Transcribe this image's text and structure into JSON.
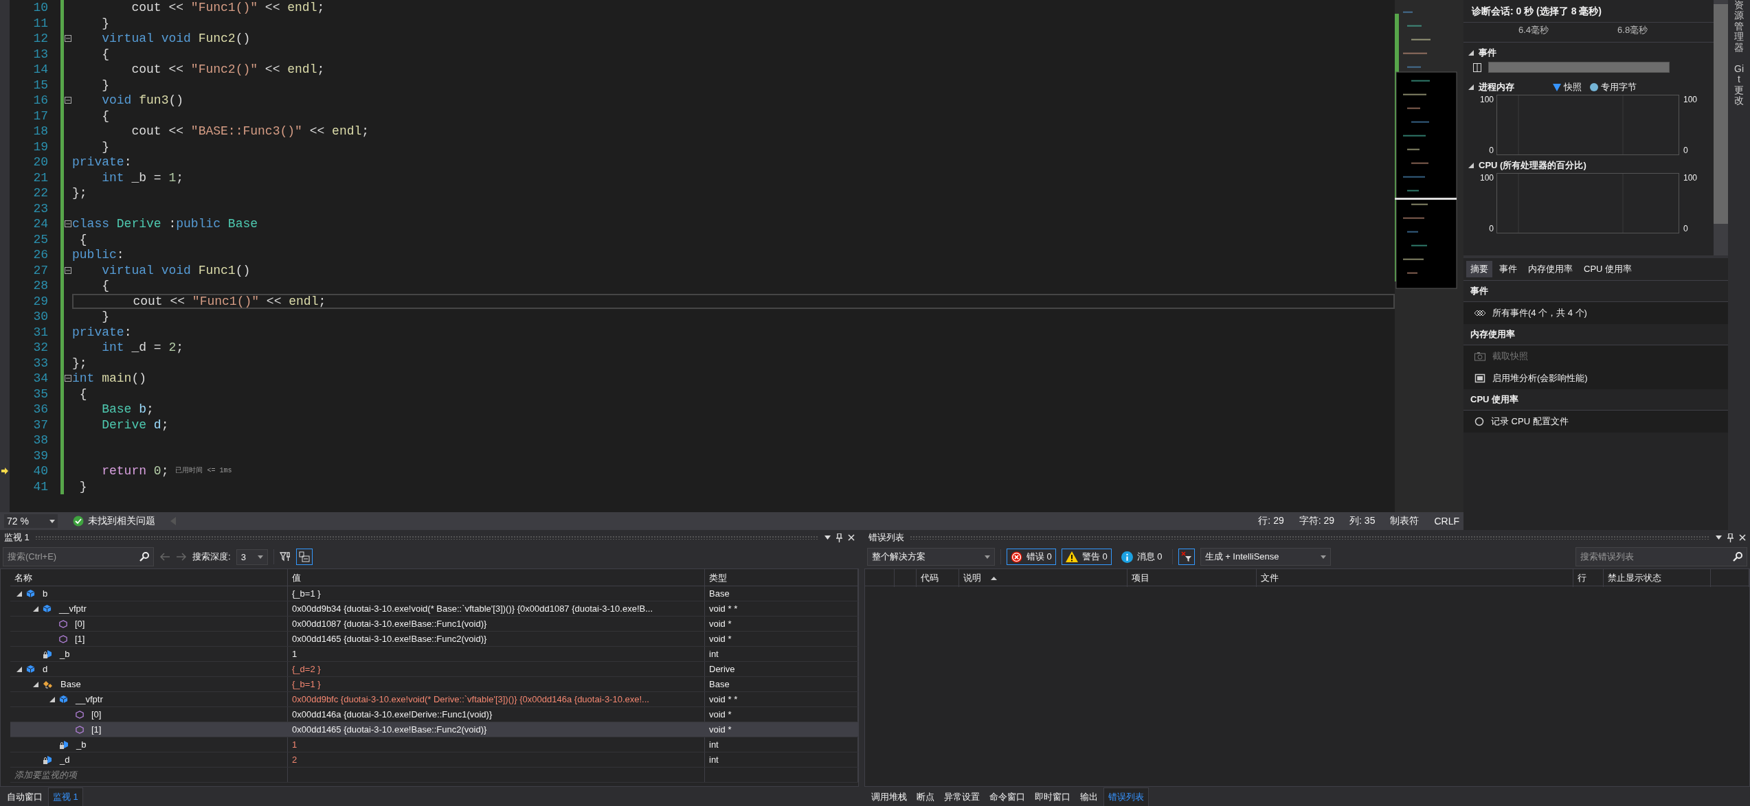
{
  "editor": {
    "lines": [
      {
        "number": "10",
        "fold": false,
        "current": false,
        "execution": false,
        "tokens": [
          {
            "text": "        cout << ",
            "kind": "plain"
          },
          {
            "text": "\"Func1()\"",
            "kind": "str"
          },
          {
            "text": " << ",
            "kind": "plain"
          },
          {
            "text": "endl",
            "kind": "fn"
          },
          {
            "text": ";",
            "kind": "plain"
          }
        ]
      },
      {
        "number": "11",
        "fold": false,
        "current": false,
        "execution": false,
        "tokens": [
          {
            "text": "    }",
            "kind": "plain"
          }
        ]
      },
      {
        "number": "12",
        "fold": true,
        "current": false,
        "execution": false,
        "tokens": [
          {
            "text": "    virtual",
            "kind": "kw"
          },
          {
            "text": " void",
            "kind": "kw"
          },
          {
            "text": " Func2",
            "kind": "fn"
          },
          {
            "text": "()",
            "kind": "plain"
          }
        ]
      },
      {
        "number": "13",
        "fold": false,
        "current": false,
        "execution": false,
        "tokens": [
          {
            "text": "    {",
            "kind": "plain"
          }
        ]
      },
      {
        "number": "14",
        "fold": false,
        "current": false,
        "execution": false,
        "tokens": [
          {
            "text": "        cout << ",
            "kind": "plain"
          },
          {
            "text": "\"Func2()\"",
            "kind": "str"
          },
          {
            "text": " << ",
            "kind": "plain"
          },
          {
            "text": "endl",
            "kind": "fn"
          },
          {
            "text": ";",
            "kind": "plain"
          }
        ]
      },
      {
        "number": "15",
        "fold": false,
        "current": false,
        "execution": false,
        "tokens": [
          {
            "text": "    }",
            "kind": "plain"
          }
        ]
      },
      {
        "number": "16",
        "fold": true,
        "current": false,
        "execution": false,
        "tokens": [
          {
            "text": "    void",
            "kind": "kw"
          },
          {
            "text": " fun3",
            "kind": "fn"
          },
          {
            "text": "()",
            "kind": "plain"
          }
        ]
      },
      {
        "number": "17",
        "fold": false,
        "current": false,
        "execution": false,
        "tokens": [
          {
            "text": "    {",
            "kind": "plain"
          }
        ]
      },
      {
        "number": "18",
        "fold": false,
        "current": false,
        "execution": false,
        "tokens": [
          {
            "text": "        cout << ",
            "kind": "plain"
          },
          {
            "text": "\"BASE::Func3()\"",
            "kind": "str"
          },
          {
            "text": " << ",
            "kind": "plain"
          },
          {
            "text": "endl",
            "kind": "fn"
          },
          {
            "text": ";",
            "kind": "plain"
          }
        ]
      },
      {
        "number": "19",
        "fold": false,
        "current": false,
        "execution": false,
        "tokens": [
          {
            "text": "    }",
            "kind": "plain"
          }
        ]
      },
      {
        "number": "20",
        "fold": false,
        "current": false,
        "execution": false,
        "tokens": [
          {
            "text": "private",
            "kind": "kw"
          },
          {
            "text": ":",
            "kind": "plain"
          }
        ]
      },
      {
        "number": "21",
        "fold": false,
        "current": false,
        "execution": false,
        "tokens": [
          {
            "text": "    int",
            "kind": "kw"
          },
          {
            "text": " _b = ",
            "kind": "plain"
          },
          {
            "text": "1",
            "kind": "num"
          },
          {
            "text": ";",
            "kind": "plain"
          }
        ]
      },
      {
        "number": "22",
        "fold": false,
        "current": false,
        "execution": false,
        "tokens": [
          {
            "text": "};",
            "kind": "plain"
          }
        ]
      },
      {
        "number": "23",
        "fold": false,
        "current": false,
        "execution": false
      },
      {
        "number": "24",
        "fold": true,
        "current": false,
        "execution": false,
        "tokens": [
          {
            "text": "class",
            "kind": "kw"
          },
          {
            "text": " Derive",
            "kind": "type"
          },
          {
            "text": " :",
            "kind": "plain"
          },
          {
            "text": "public",
            "kind": "kw"
          },
          {
            "text": " Base",
            "kind": "type"
          }
        ]
      },
      {
        "number": "25",
        "fold": false,
        "current": false,
        "execution": false,
        "tokens": [
          {
            "text": " {",
            "kind": "plain"
          }
        ]
      },
      {
        "number": "26",
        "fold": false,
        "current": false,
        "execution": false,
        "tokens": [
          {
            "text": "public",
            "kind": "kw"
          },
          {
            "text": ":",
            "kind": "plain"
          }
        ]
      },
      {
        "number": "27",
        "fold": true,
        "current": false,
        "execution": false,
        "tokens": [
          {
            "text": "    virtual",
            "kind": "kw"
          },
          {
            "text": " void",
            "kind": "kw"
          },
          {
            "text": " Func1",
            "kind": "fn"
          },
          {
            "text": "()",
            "kind": "plain"
          }
        ]
      },
      {
        "number": "28",
        "fold": false,
        "current": false,
        "execution": false,
        "tokens": [
          {
            "text": "    {",
            "kind": "plain"
          }
        ]
      },
      {
        "number": "29",
        "fold": false,
        "current": true,
        "execution": false,
        "tokens": [
          {
            "text": "        cout << ",
            "kind": "plain"
          },
          {
            "text": "\"Func1()\"",
            "kind": "str"
          },
          {
            "text": " << ",
            "kind": "plain"
          },
          {
            "text": "endl",
            "kind": "fn"
          },
          {
            "text": ";",
            "kind": "plain"
          }
        ]
      },
      {
        "number": "30",
        "fold": false,
        "current": false,
        "execution": false,
        "tokens": [
          {
            "text": "    }",
            "kind": "plain"
          }
        ]
      },
      {
        "number": "31",
        "fold": false,
        "current": false,
        "execution": false,
        "tokens": [
          {
            "text": "private",
            "kind": "kw"
          },
          {
            "text": ":",
            "kind": "plain"
          }
        ]
      },
      {
        "number": "32",
        "fold": false,
        "current": false,
        "execution": false,
        "tokens": [
          {
            "text": "    int",
            "kind": "kw"
          },
          {
            "text": " _d = ",
            "kind": "plain"
          },
          {
            "text": "2",
            "kind": "num"
          },
          {
            "text": ";",
            "kind": "plain"
          }
        ]
      },
      {
        "number": "33",
        "fold": false,
        "current": false,
        "execution": false,
        "tokens": [
          {
            "text": "};",
            "kind": "plain"
          }
        ]
      },
      {
        "number": "34",
        "fold": true,
        "current": false,
        "execution": false,
        "tokens": [
          {
            "text": "int",
            "kind": "kw"
          },
          {
            "text": " main",
            "kind": "fn"
          },
          {
            "text": "()",
            "kind": "plain"
          }
        ]
      },
      {
        "number": "35",
        "fold": false,
        "current": false,
        "execution": false,
        "tokens": [
          {
            "text": " {",
            "kind": "plain"
          }
        ]
      },
      {
        "number": "36",
        "fold": false,
        "current": false,
        "execution": false,
        "tokens": [
          {
            "text": "    Base",
            "kind": "type"
          },
          {
            "text": " b",
            "kind": "var"
          },
          {
            "text": ";",
            "kind": "plain"
          }
        ]
      },
      {
        "number": "37",
        "fold": false,
        "current": false,
        "execution": false,
        "tokens": [
          {
            "text": "    Derive",
            "kind": "type"
          },
          {
            "text": " d",
            "kind": "var"
          },
          {
            "text": ";",
            "kind": "plain"
          }
        ]
      },
      {
        "number": "38",
        "fold": false,
        "current": false,
        "execution": false
      },
      {
        "number": "39",
        "fold": false,
        "current": false,
        "execution": false
      },
      {
        "number": "40",
        "fold": false,
        "current": false,
        "execution": true,
        "tokens": [
          {
            "text": "    return",
            "kind": "ctl"
          },
          {
            "text": " 0",
            "kind": "num"
          },
          {
            "text": ";",
            "kind": "plain"
          }
        ],
        "hint": "已用时间 <= 1ms"
      },
      {
        "number": "41",
        "fold": false,
        "current": false,
        "execution": false,
        "tokens": [
          {
            "text": " }",
            "kind": "plain"
          }
        ]
      }
    ]
  },
  "status_bar": {
    "zoom": "72 %",
    "issues": "未找到相关问题",
    "items": [
      "行: 29",
      "字符: 29",
      "列: 35",
      "制表符",
      "CRLF"
    ]
  },
  "diagnostics": {
    "title": "诊断会话: 0 秒 (选择了 8 毫秒)",
    "ruler_labels": [
      "6.4毫秒",
      "6.8毫秒"
    ],
    "graphs": [
      {
        "kind": "events",
        "title": "事件",
        "expanded": true
      },
      {
        "kind": "chart",
        "title": "进程内存",
        "expanded": true,
        "legend": [
          {
            "label": "快照",
            "kind": "triangle",
            "color": "#3794ff"
          },
          {
            "label": "专用字节",
            "kind": "circle",
            "color": "#75b4d6"
          }
        ],
        "left_axis": [
          "100",
          "0"
        ],
        "right_axis": [
          "100",
          "0"
        ]
      },
      {
        "kind": "chart",
        "title": "CPU (所有处理器的百分比)",
        "expanded": true,
        "left_axis": [
          "100",
          "0"
        ],
        "right_axis": [
          "100",
          "0"
        ]
      }
    ],
    "tabs": [
      {
        "label": "摘要",
        "selected": true
      },
      {
        "label": "事件",
        "selected": false
      },
      {
        "label": "内存使用率",
        "selected": false
      },
      {
        "label": "CPU 使用率",
        "selected": false
      }
    ],
    "sections": [
      {
        "title": "事件",
        "items": [
          {
            "label": "所有事件(4 个，共 4 个)",
            "kind": "events",
            "disabled": false
          }
        ]
      },
      {
        "title": "内存使用率",
        "items": [
          {
            "label": "截取快照",
            "kind": "snapshot",
            "disabled": true
          },
          {
            "label": "启用堆分析(会影响性能)",
            "kind": "heap",
            "disabled": false
          }
        ]
      },
      {
        "title": "CPU 使用率",
        "items": [
          {
            "label": "记录 CPU 配置文件",
            "kind": "record",
            "disabled": false
          }
        ]
      }
    ]
  },
  "side_tabs": [
    "资源管理器",
    "Git 更改"
  ],
  "watch": {
    "title": "监视 1",
    "search_placeholder": "搜索(Ctrl+E)",
    "depth_label": "搜索深度:",
    "depth": "3",
    "columns": [
      "名称",
      "值",
      "类型"
    ],
    "rows": [
      {
        "name": "b",
        "value": "{_b=1 }",
        "type": "Base",
        "kind": "object",
        "expanded": true,
        "changed": false,
        "selected": false,
        "children": [
          {
            "name": "__vfptr",
            "value": "0x00dd9b34 {duotai-3-10.exe!void(* Base::`vftable'[3])()} {0x00dd1087 {duotai-3-10.exe!B...",
            "type": "void * *",
            "kind": "object",
            "expanded": true,
            "changed": false,
            "selected": false,
            "children": [
              {
                "name": "[0]",
                "value": "0x00dd1087 {duotai-3-10.exe!Base::Func1(void)}",
                "type": "void *",
                "kind": "member",
                "changed": false,
                "selected": false
              },
              {
                "name": "[1]",
                "value": "0x00dd1465 {duotai-3-10.exe!Base::Func2(void)}",
                "type": "void *",
                "kind": "member",
                "changed": false,
                "selected": false
              }
            ]
          },
          {
            "name": "_b",
            "value": "1",
            "type": "int",
            "kind": "field",
            "changed": false,
            "selected": false
          }
        ]
      },
      {
        "name": "d",
        "value": "{_d=2 }",
        "type": "Derive",
        "kind": "object",
        "expanded": true,
        "changed": true,
        "selected": false,
        "children": [
          {
            "name": "Base",
            "value": "{_b=1 }",
            "type": "Base",
            "kind": "base",
            "expanded": true,
            "changed": true,
            "selected": false,
            "children": [
              {
                "name": "__vfptr",
                "value": "0x00dd9bfc {duotai-3-10.exe!void(* Derive::`vftable'[3])()} {0x00dd146a {duotai-3-10.exe!...",
                "type": "void * *",
                "kind": "object",
                "expanded": true,
                "changed": true,
                "selected": false,
                "children": [
                  {
                    "name": "[0]",
                    "value": "0x00dd146a {duotai-3-10.exe!Derive::Func1(void)}",
                    "type": "void *",
                    "kind": "member",
                    "changed": false,
                    "selected": false
                  },
                  {
                    "name": "[1]",
                    "value": "0x00dd1465 {duotai-3-10.exe!Base::Func2(void)}",
                    "type": "void *",
                    "kind": "member",
                    "changed": false,
                    "selected": true
                  }
                ]
              },
              {
                "name": "_b",
                "value": "1",
                "type": "int",
                "kind": "field",
                "changed": true,
                "selected": false
              }
            ]
          },
          {
            "name": "_d",
            "value": "2",
            "type": "int",
            "kind": "field",
            "changed": true,
            "selected": false
          }
        ]
      }
    ],
    "add_placeholder": "添加要监视的项",
    "tabs": [
      {
        "label": "自动窗口",
        "selected": false
      },
      {
        "label": "监视 1",
        "selected": true
      }
    ]
  },
  "error_list": {
    "title": "错误列表",
    "scope": "整个解决方案",
    "filters": [
      {
        "kind": "error",
        "label": "错误 0",
        "selected": true
      },
      {
        "kind": "warning",
        "label": "警告 0",
        "selected": true
      },
      {
        "kind": "info",
        "label": "消息 0",
        "selected": false
      }
    ],
    "source": "生成 + IntelliSense",
    "search_placeholder": "搜索错误列表",
    "columns": [
      "代码",
      "说明",
      "项目",
      "文件",
      "行",
      "禁止显示状态"
    ],
    "tabs": [
      {
        "label": "调用堆栈",
        "selected": false
      },
      {
        "label": "断点",
        "selected": false
      },
      {
        "label": "异常设置",
        "selected": false
      },
      {
        "label": "命令窗口",
        "selected": false
      },
      {
        "label": "即时窗口",
        "selected": false
      },
      {
        "label": "输出",
        "selected": false
      },
      {
        "label": "错误列表",
        "selected": true
      }
    ]
  }
}
